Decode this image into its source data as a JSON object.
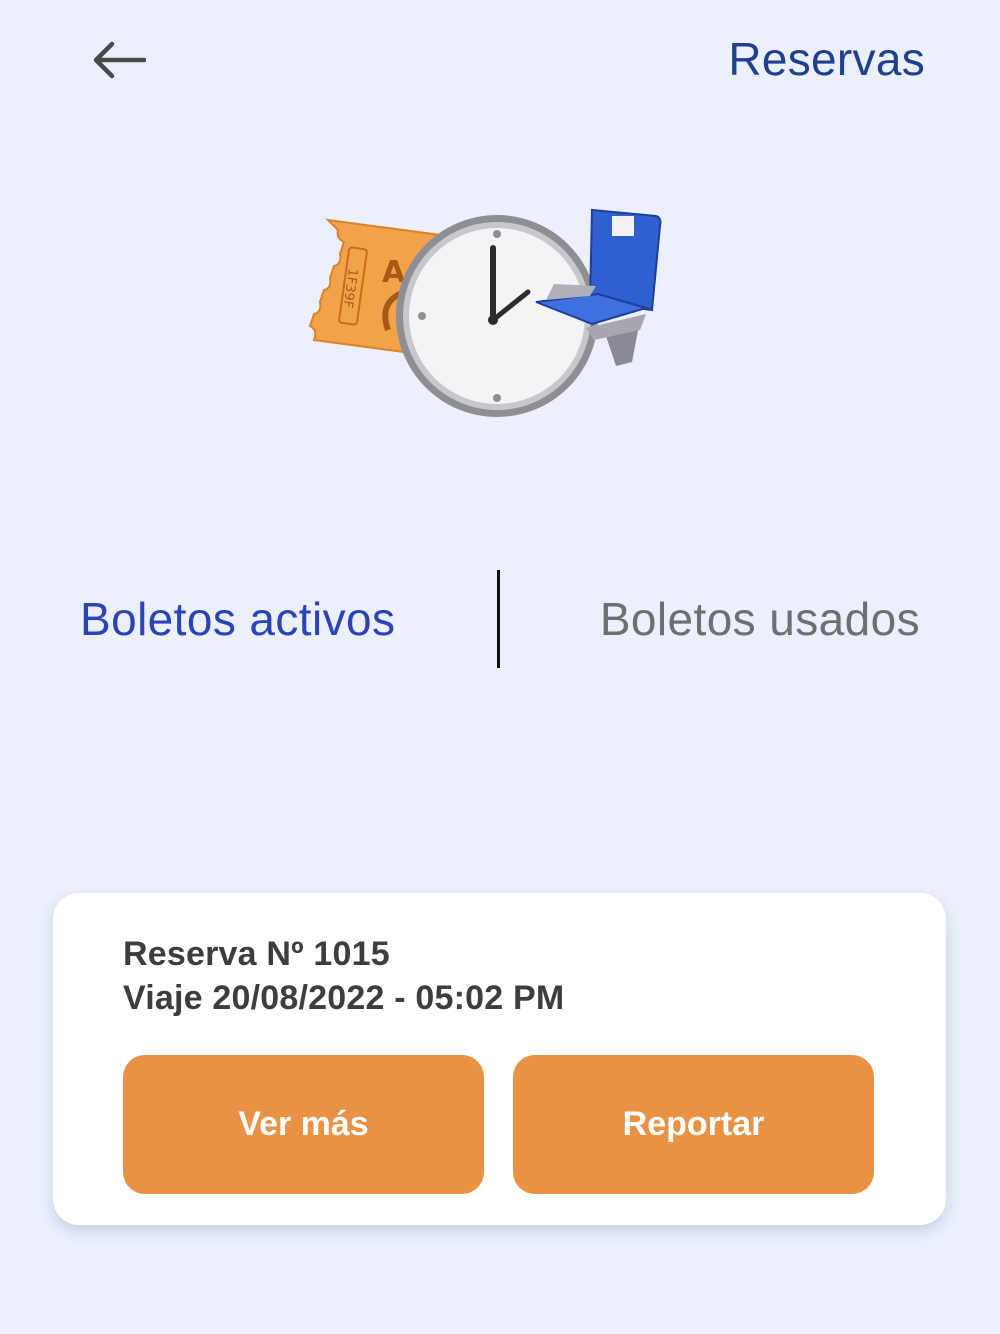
{
  "header": {
    "title": "Reservas",
    "back_icon": "arrow-left-icon"
  },
  "hero": {
    "icons": [
      "ticket-icon",
      "clock-icon",
      "seat-icon"
    ],
    "ticket_code_partial": "1F39F",
    "ticket_letter": "A",
    "colors": {
      "ticket": "#f2a34a",
      "seat": "#2f5fd0"
    }
  },
  "tabs": {
    "active_label": "Boletos activos",
    "used_label": "Boletos usados",
    "selected": "Boletos activos",
    "active_color": "#2a44b8",
    "inactive_color": "#6f6f6f"
  },
  "reservation": {
    "number_line": "Reserva Nº 1015",
    "trip_line": "Viaje 20/08/2022 - 05:02 PM",
    "buttons": {
      "more_label": "Ver más",
      "report_label": "Reportar"
    },
    "button_color": "#e99245"
  },
  "colors": {
    "background": "#ebf0fc",
    "title": "#1f3f8f"
  }
}
